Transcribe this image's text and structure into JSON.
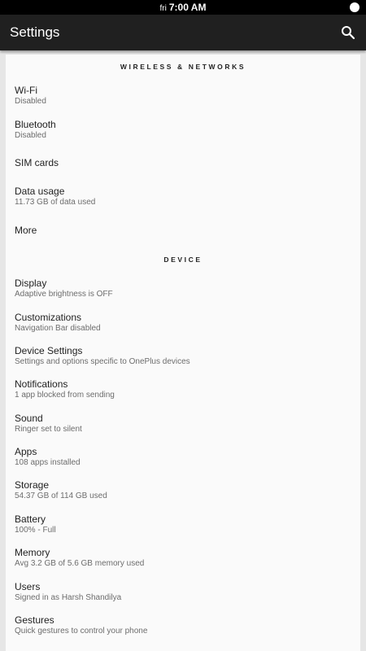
{
  "status_bar": {
    "day": "fri",
    "time": "7:00 AM"
  },
  "app_bar": {
    "title": "Settings",
    "search_icon": "search-icon"
  },
  "sections": [
    {
      "header": "WIRELESS & NETWORKS",
      "items": [
        {
          "title": "Wi-Fi",
          "summary": "Disabled"
        },
        {
          "title": "Bluetooth",
          "summary": "Disabled"
        },
        {
          "title": "SIM cards",
          "summary": ""
        },
        {
          "title": "Data usage",
          "summary": "11.73 GB of data used"
        },
        {
          "title": "More",
          "summary": ""
        }
      ]
    },
    {
      "header": "DEVICE",
      "items": [
        {
          "title": "Display",
          "summary": "Adaptive brightness is OFF"
        },
        {
          "title": "Customizations",
          "summary": "Navigation Bar disabled"
        },
        {
          "title": "Device Settings",
          "summary": "Settings and options specific to OnePlus devices"
        },
        {
          "title": "Notifications",
          "summary": "1 app blocked from sending"
        },
        {
          "title": "Sound",
          "summary": "Ringer set to silent"
        },
        {
          "title": "Apps",
          "summary": "108 apps installed"
        },
        {
          "title": "Storage",
          "summary": "54.37 GB of 114 GB used"
        },
        {
          "title": "Battery",
          "summary": "100% - Full"
        },
        {
          "title": "Memory",
          "summary": "Avg 3.2 GB of 5.6 GB memory used"
        },
        {
          "title": "Users",
          "summary": "Signed in as Harsh Shandilya"
        },
        {
          "title": "Gestures",
          "summary": "Quick gestures to control your phone"
        }
      ]
    }
  ],
  "colors": {
    "status_bar": "#000000",
    "app_bar": "#202020",
    "background": "#e6e6e6",
    "card": "#fafafa",
    "title_text": "#1f1f1f",
    "summary_text": "#6d6d6d"
  }
}
